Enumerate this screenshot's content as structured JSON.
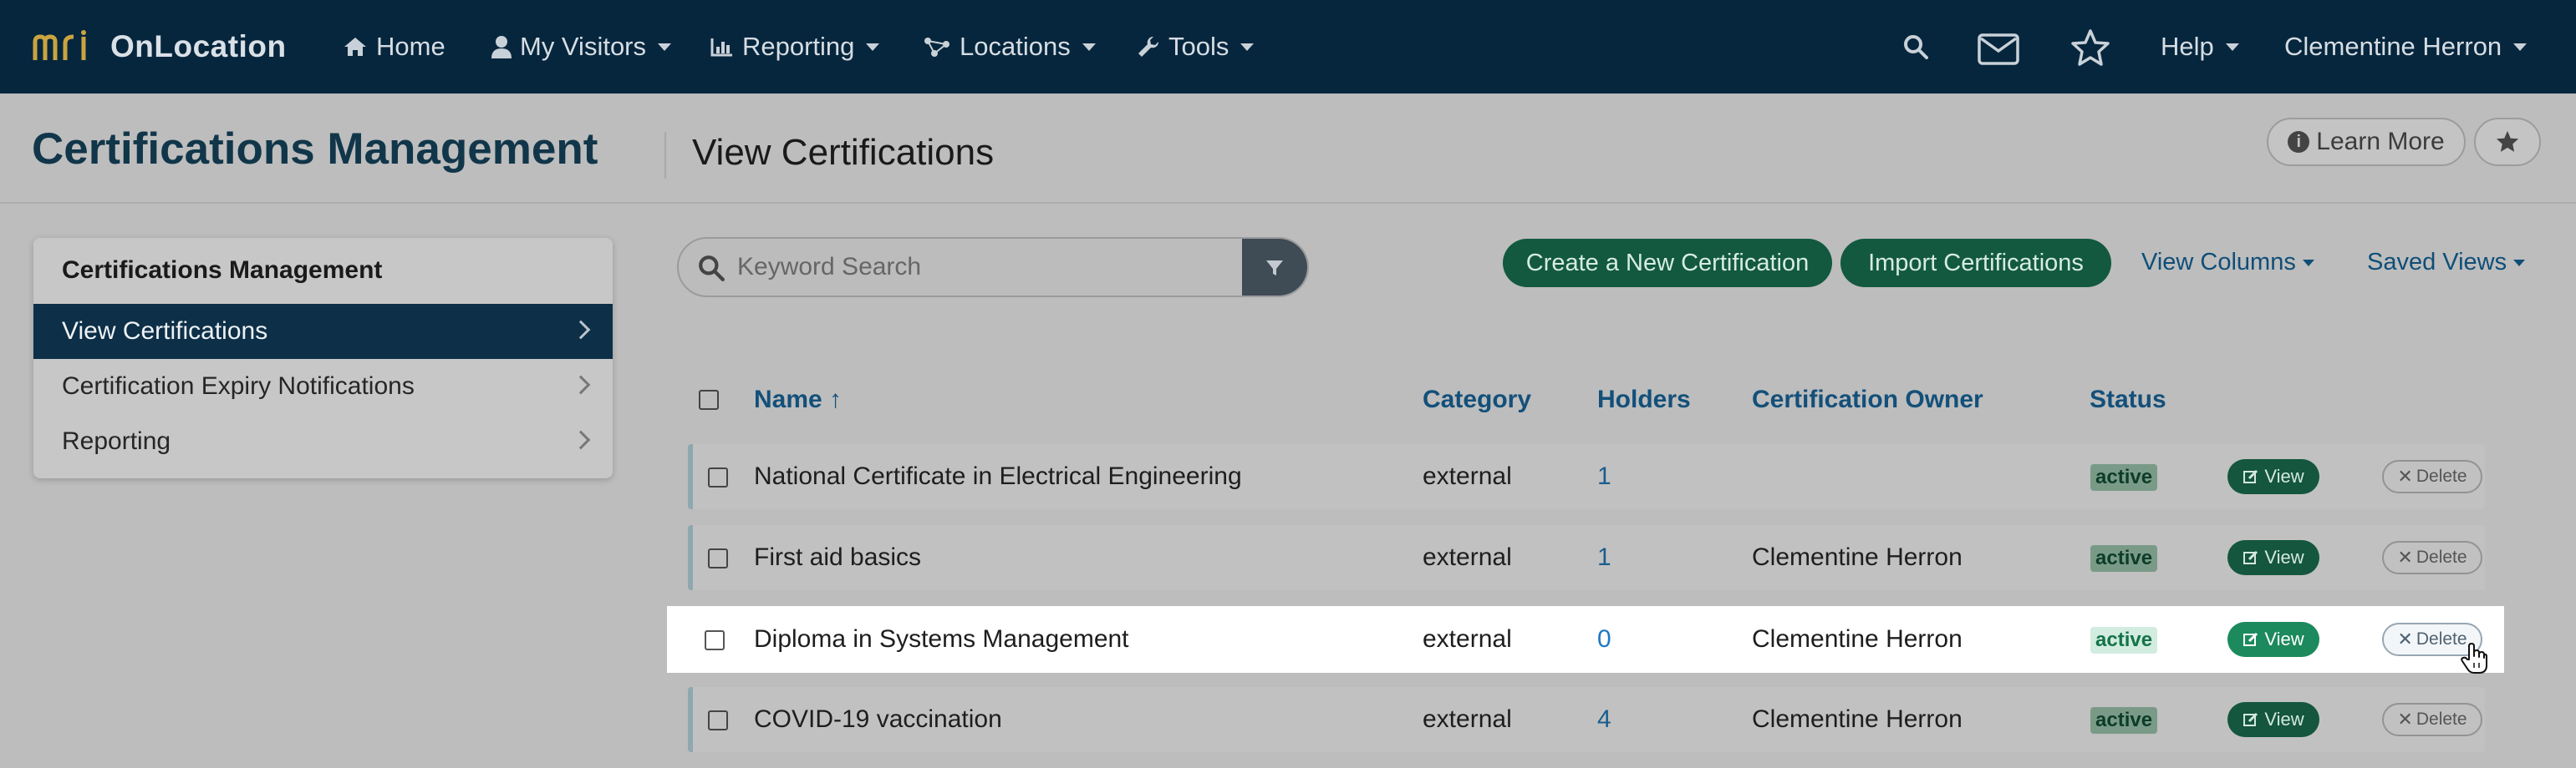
{
  "app": {
    "name": "OnLocation"
  },
  "nav": {
    "items": [
      {
        "label": "Home",
        "icon": "home-icon"
      },
      {
        "label": "My Visitors",
        "icon": "user-icon"
      },
      {
        "label": "Reporting",
        "icon": "bar-chart-icon"
      },
      {
        "label": "Locations",
        "icon": "network-icon"
      },
      {
        "label": "Tools",
        "icon": "wrench-icon"
      }
    ],
    "help_label": "Help",
    "user_name": "Clementine Herron"
  },
  "header": {
    "title": "Certifications Management",
    "subtitle": "View Certifications",
    "learn_more": "Learn More"
  },
  "sidebar": {
    "title": "Certifications Management",
    "items": [
      {
        "label": "View Certifications",
        "active": true
      },
      {
        "label": "Certification Expiry Notifications",
        "active": false
      },
      {
        "label": "Reporting",
        "active": false
      }
    ]
  },
  "search": {
    "placeholder": "Keyword Search",
    "value": ""
  },
  "actions": {
    "create": "Create a New Certification",
    "import": "Import Certifications",
    "view_columns": "View Columns",
    "saved_views": "Saved Views"
  },
  "table": {
    "columns": {
      "name": "Name ↑",
      "category": "Category",
      "holders": "Holders",
      "owner": "Certification Owner",
      "status": "Status"
    },
    "rows": [
      {
        "name": "National Certificate in Electrical Engineering",
        "category": "external",
        "holders": "1",
        "owner": "",
        "status": "active",
        "view": "View",
        "delete": "Delete"
      },
      {
        "name": "First aid basics",
        "category": "external",
        "holders": "1",
        "owner": "Clementine Herron",
        "status": "active",
        "view": "View",
        "delete": "Delete"
      },
      {
        "name": "Diploma in Systems Management",
        "category": "external",
        "holders": "0",
        "owner": "Clementine Herron",
        "status": "active",
        "view": "View",
        "delete": "Delete"
      },
      {
        "name": "COVID-19 vaccination",
        "category": "external",
        "holders": "4",
        "owner": "Clementine Herron",
        "status": "active",
        "view": "View",
        "delete": "Delete"
      }
    ]
  },
  "colors": {
    "navbar": "#06263d",
    "brand_logo": "#c9a441",
    "primary_green": "#13593f",
    "link_blue": "#13507a"
  }
}
